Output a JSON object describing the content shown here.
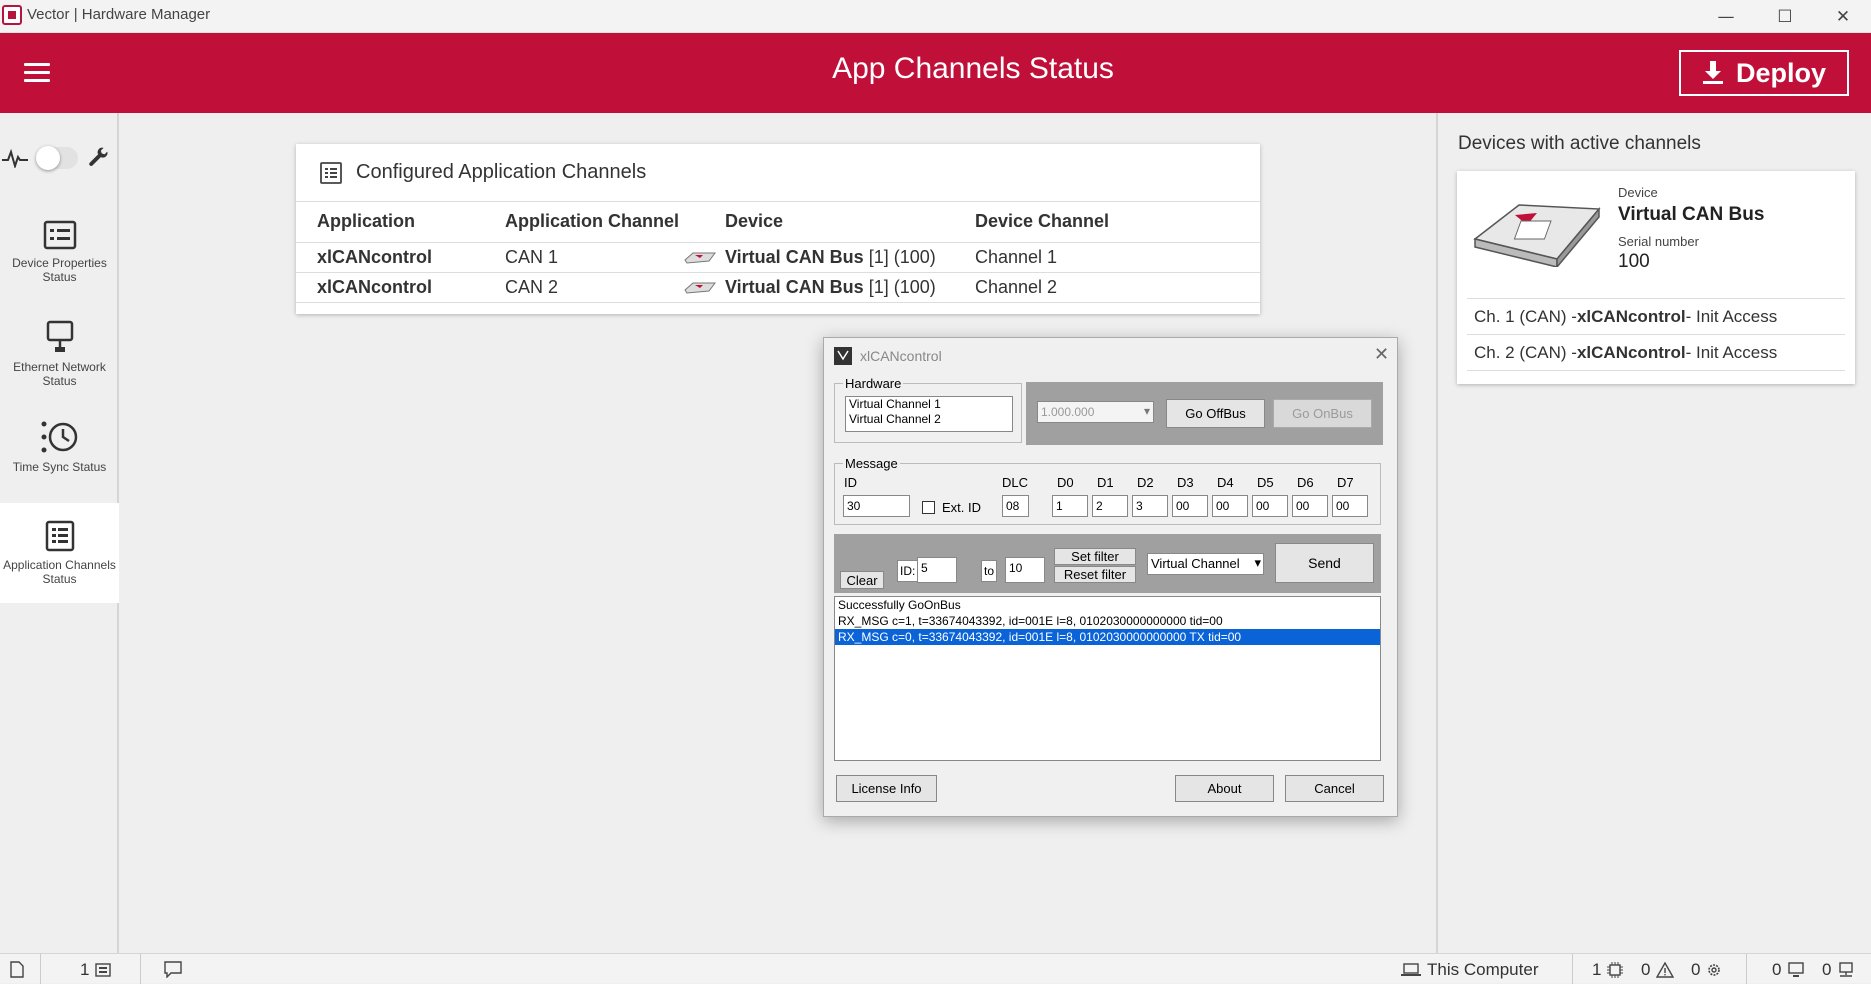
{
  "window": {
    "title": "Vector | Hardware Manager",
    "controls": {
      "minimize": "—",
      "maximize": "☐",
      "close": "✕"
    }
  },
  "header": {
    "title": "App Channels Status",
    "deploy_label": "Deploy",
    "accent": "#c0103a"
  },
  "sidebar": {
    "items": [
      {
        "label": "Device Properties Status",
        "icon": "device-properties-icon"
      },
      {
        "label": "Ethernet Network Status",
        "icon": "ethernet-icon"
      },
      {
        "label": "Time Sync Status",
        "icon": "time-sync-icon"
      },
      {
        "label": "Application Channels Status",
        "icon": "app-channels-icon",
        "active": true
      }
    ]
  },
  "card": {
    "title": "Configured Application Channels",
    "columns": [
      "Application",
      "Application Channel",
      "Device",
      "Device Channel"
    ],
    "rows": [
      {
        "application": "xlCANcontrol",
        "app_channel": "CAN 1",
        "device_name": "Virtual CAN Bus",
        "device_suffix": " [1] (100)",
        "device_channel": "Channel 1"
      },
      {
        "application": "xlCANcontrol",
        "app_channel": "CAN 2",
        "device_name": "Virtual CAN Bus",
        "device_suffix": " [1] (100)",
        "device_channel": "Channel 2"
      }
    ]
  },
  "right": {
    "title": "Devices with active channels",
    "device_label": "Device",
    "device_name": "Virtual CAN Bus",
    "serial_label": "Serial number",
    "serial": "100",
    "channels": [
      {
        "prefix": "Ch. 1 (CAN) - ",
        "app": "xlCANcontrol",
        "suffix": " - Init Access"
      },
      {
        "prefix": "Ch. 2 (CAN) - ",
        "app": "xlCANcontrol",
        "suffix": " - Init Access"
      }
    ]
  },
  "dialog": {
    "title": "xlCANcontrol",
    "hardware_label": "Hardware",
    "hardware_items": [
      "Virtual Channel 1",
      "Virtual Channel 2"
    ],
    "baudrate": "1.000.000",
    "go_offbus": "Go OffBus",
    "go_onbus": "Go OnBus",
    "message_label": "Message",
    "id_label": "ID",
    "id_value": "30",
    "ext_id_label": "Ext. ID",
    "dlc_label": "DLC",
    "dlc_value": "08",
    "data_labels": [
      "D0",
      "D1",
      "D2",
      "D3",
      "D4",
      "D5",
      "D6",
      "D7"
    ],
    "data_values": [
      "1",
      "2",
      "3",
      "00",
      "00",
      "00",
      "00",
      "00"
    ],
    "clear": "Clear",
    "filter_id_label": "ID:",
    "filter_from": "5",
    "filter_to_label": "to",
    "filter_to": "10",
    "set_filter": "Set filter",
    "reset_filter": "Reset filter",
    "channel_select": "Virtual Channel",
    "send": "Send",
    "log": [
      "Successfully GoOnBus",
      "RX_MSG c=1, t=33674043392, id=001E l=8, 0102030000000000 tid=00",
      "RX_MSG c=0, t=33674043392, id=001E l=8, 0102030000000000 TX tid=00"
    ],
    "license_info": "License Info",
    "about": "About",
    "cancel": "Cancel"
  },
  "statusbar": {
    "count_a": "1",
    "computer": "This Computer",
    "s1": "1",
    "s2": "0",
    "s3": "0",
    "s4": "0",
    "s5": "0"
  }
}
